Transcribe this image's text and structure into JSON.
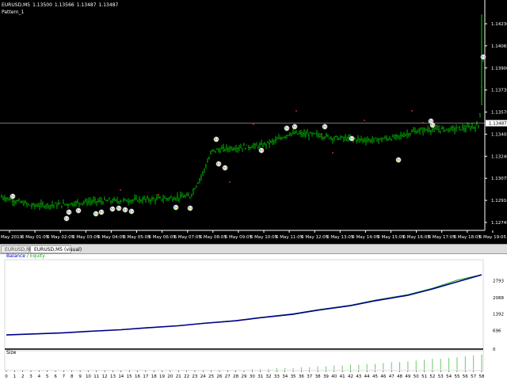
{
  "chart_header": {
    "symbol": "EURUSD,M5",
    "open": "1.13500",
    "high": "1.13566",
    "low": "1.13487",
    "close": "1.13487",
    "indicator": "Pattern_1"
  },
  "price_axis": {
    "labels": [
      "1.14230",
      "1.14065",
      "1.13900",
      "1.13735",
      "1.13570",
      "1.13405",
      "1.13240",
      "1.13075",
      "1.12910",
      "1.12745"
    ],
    "current_price": "1.13487"
  },
  "time_axis": {
    "labels": [
      "6 May 2019",
      "6 May 01:05",
      "6 May 02:05",
      "6 May 03:05",
      "6 May 04:05",
      "6 May 05:05",
      "6 May 06:05",
      "6 May 07:05",
      "6 May 08:05",
      "6 May 09:05",
      "6 May 10:05",
      "6 May 11:05",
      "6 May 12:05",
      "6 May 13:05",
      "6 May 14:05",
      "6 May 15:05",
      "6 May 16:05",
      "6 May 17:05",
      "6 May 18:05",
      "6 May 19:05"
    ]
  },
  "tabs": [
    {
      "label": "EURUSD,M1",
      "active": false
    },
    {
      "label": "EURUSD,M5 (visual)",
      "active": true
    }
  ],
  "report": {
    "legend_balance": "Balance",
    "legend_separator": "/",
    "legend_equity": "Equity",
    "size_label": "Size",
    "zero_label": "0",
    "x_labels": [
      "0",
      "1",
      "2",
      "3",
      "4",
      "5",
      "6",
      "7",
      "8",
      "9",
      "10",
      "11",
      "12",
      "13",
      "14",
      "15",
      "16",
      "17",
      "18",
      "19",
      "20",
      "21",
      "22",
      "23",
      "24",
      "25",
      "26",
      "27",
      "28",
      "29",
      "30",
      "31",
      "32",
      "33",
      "34",
      "35",
      "36",
      "37",
      "38",
      "39",
      "40",
      "41",
      "42",
      "43",
      "44",
      "45",
      "46",
      "47",
      "48",
      "49",
      "50",
      "51",
      "52",
      "53",
      "54",
      "55",
      "56",
      "57",
      "58"
    ]
  },
  "colors": {
    "bullish": "#00b400",
    "balance": "#00008b",
    "equity": "#22aa22",
    "size_bars": "#66cc66"
  },
  "chart_data": [
    {
      "type": "bar",
      "title": "",
      "series": [
        {
          "name": "EURUSD,M5",
          "values": [
            1.1293,
            1.1288,
            1.1289,
            1.129,
            1.1291,
            1.1294,
            1.1327,
            1.133,
            1.1336,
            1.1339,
            1.1337,
            1.1337,
            1.1337,
            1.1341,
            1.1342,
            1.1343,
            1.1345,
            1.1356,
            1.1359,
            1.1361
          ]
        }
      ],
      "x": [
        "6 May 2019",
        "6 May 01:05",
        "6 May 02:05",
        "6 May 03:05",
        "6 May 04:05",
        "6 May 05:05",
        "6 May 06:05",
        "6 May 07:05",
        "6 May 08:05",
        "6 May 09:05",
        "6 May 10:05",
        "6 May 11:05",
        "6 May 12:05",
        "6 May 13:05",
        "6 May 14:05",
        "6 May 15:05",
        "6 May 16:05",
        "6 May 17:05",
        "6 May 18:05",
        "6 May 19:05"
      ],
      "ylim": [
        1.127,
        1.143
      ]
    },
    {
      "type": "line",
      "series": [
        {
          "name": "Balance",
          "values": [
            500,
            540,
            590,
            650,
            720,
            800,
            890,
            990,
            1100,
            1230,
            1380,
            1550,
            1740,
            1950,
            2180,
            2450,
            2750,
            3050
          ]
        },
        {
          "name": "Equity",
          "values": [
            500,
            540,
            592,
            652,
            724,
            805,
            896,
            998,
            1112,
            1242,
            1398,
            1570,
            1760,
            1975,
            2210,
            2480,
            2820,
            3060
          ]
        }
      ],
      "x": [
        0,
        3,
        7,
        10,
        14,
        17,
        21,
        24,
        28,
        31,
        35,
        38,
        42,
        45,
        49,
        52,
        55,
        58
      ],
      "y_tick_labels": [
        "2793",
        "2088",
        "1392",
        "696",
        "0"
      ],
      "ylim": [
        0,
        3489
      ]
    },
    {
      "type": "bar",
      "series": [
        {
          "name": "Size",
          "values": [
            0,
            0,
            0,
            0,
            0,
            0,
            0,
            0,
            0,
            0,
            0,
            0,
            0,
            0,
            0,
            0,
            0,
            0,
            0,
            0,
            0,
            0,
            0,
            0,
            0,
            0,
            0,
            0,
            0,
            0,
            1,
            1,
            1,
            2,
            2,
            2,
            3,
            3,
            4,
            4,
            5,
            5,
            6,
            6,
            7,
            7,
            8,
            9,
            9,
            10,
            11,
            12,
            13,
            13,
            14,
            15,
            16,
            17,
            18
          ]
        }
      ],
      "x": [
        0,
        1,
        2,
        3,
        4,
        5,
        6,
        7,
        8,
        9,
        10,
        11,
        12,
        13,
        14,
        15,
        16,
        17,
        18,
        19,
        20,
        21,
        22,
        23,
        24,
        25,
        26,
        27,
        28,
        29,
        30,
        31,
        32,
        33,
        34,
        35,
        36,
        37,
        38,
        39,
        40,
        41,
        42,
        43,
        44,
        45,
        46,
        47,
        48,
        49,
        50,
        51,
        52,
        53,
        54,
        55,
        56,
        57,
        58
      ]
    }
  ]
}
